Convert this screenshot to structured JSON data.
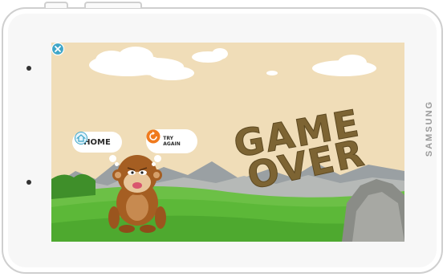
{
  "device": {
    "brand": "SAMSUNG"
  },
  "game": {
    "title_line1": "GAME",
    "title_line2": "OVER",
    "home_label": "HOME",
    "try_again_line1": "TRY",
    "try_again_line2": "AGAIN"
  },
  "icons": [
    "home-icon",
    "retry-icon",
    "close-icon"
  ],
  "colors": {
    "sky": "#f0ddb8",
    "grass": "#5cb838",
    "game_over_text": "#7d6433",
    "monkey": "#a55e22",
    "retry_orange": "#f07a1e",
    "close_teal": "#3fa6c8"
  }
}
